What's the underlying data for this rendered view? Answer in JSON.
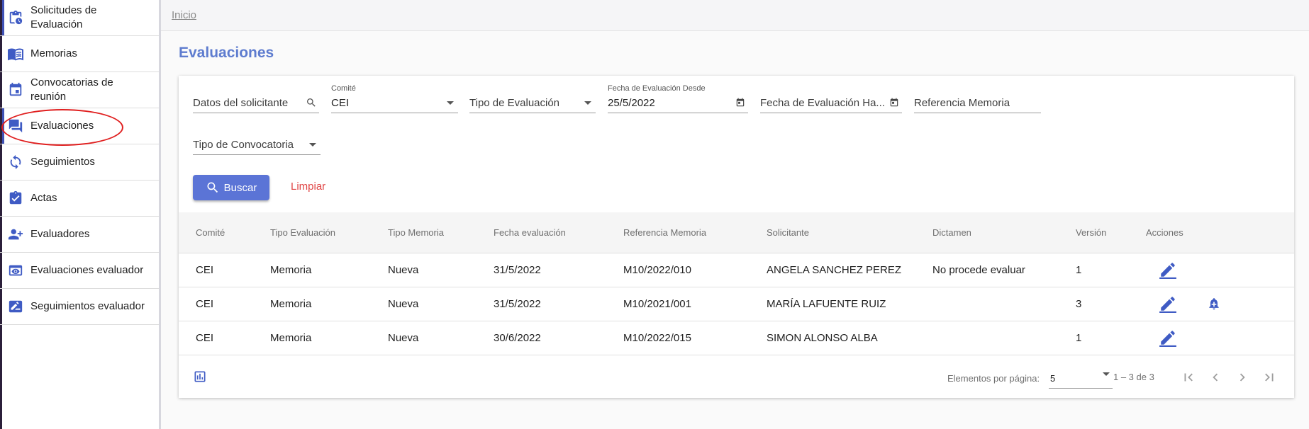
{
  "sidebar": {
    "items": [
      {
        "label_line1": "Solicitudes de",
        "label_line2": "Evaluación",
        "icon": "clipboard-clock-icon"
      },
      {
        "label": "Memorias",
        "icon": "book-icon"
      },
      {
        "label_line1": "Convocatorias de",
        "label_line2": "reunión",
        "icon": "calendar-icon"
      },
      {
        "label": "Evaluaciones",
        "icon": "chat-icon"
      },
      {
        "label": "Seguimientos",
        "icon": "sync-icon"
      },
      {
        "label": "Actas",
        "icon": "clipboard-check-icon"
      },
      {
        "label": "Evaluadores",
        "icon": "person-add-icon"
      },
      {
        "label": "Evaluaciones evaluador",
        "icon": "eye-card-icon"
      },
      {
        "label": "Seguimientos evaluador",
        "icon": "edit-card-icon"
      }
    ]
  },
  "breadcrumb": {
    "home": "Inicio"
  },
  "page": {
    "title": "Evaluaciones"
  },
  "filters": {
    "solicitante": {
      "placeholder": "Datos del solicitante"
    },
    "comite": {
      "label": "Comité",
      "value": "CEI"
    },
    "tipo_evaluacion": {
      "placeholder": "Tipo de Evaluación"
    },
    "fecha_desde": {
      "label": "Fecha de Evaluación Desde",
      "value": "25/5/2022"
    },
    "fecha_hasta": {
      "placeholder": "Fecha de Evaluación Ha..."
    },
    "referencia": {
      "placeholder": "Referencia Memoria"
    },
    "tipo_convocatoria": {
      "placeholder": "Tipo de Convocatoria"
    }
  },
  "actions": {
    "search_label": "Buscar",
    "clear_label": "Limpiar"
  },
  "table": {
    "columns": [
      "Comité",
      "Tipo Evaluación",
      "Tipo Memoria",
      "Fecha evaluación",
      "Referencia Memoria",
      "Solicitante",
      "Dictamen",
      "Versión",
      "Acciones"
    ],
    "rows": [
      {
        "comite": "CEI",
        "tipo_evaluacion": "Memoria",
        "tipo_memoria": "Nueva",
        "fecha": "31/5/2022",
        "referencia": "M10/2022/010",
        "solicitante": "ANGELA SANCHEZ PEREZ",
        "dictamen": "No procede evaluar",
        "version": "1",
        "actions": [
          "edit-icon"
        ]
      },
      {
        "comite": "CEI",
        "tipo_evaluacion": "Memoria",
        "tipo_memoria": "Nueva",
        "fecha": "31/5/2022",
        "referencia": "M10/2021/001",
        "solicitante": "MARÍA LAFUENTE RUIZ",
        "dictamen": "",
        "version": "3",
        "actions": [
          "edit-icon",
          "bell-add-icon"
        ]
      },
      {
        "comite": "CEI",
        "tipo_evaluacion": "Memoria",
        "tipo_memoria": "Nueva",
        "fecha": "30/6/2022",
        "referencia": "M10/2022/015",
        "solicitante": "SIMON ALONSO ALBA",
        "dictamen": "",
        "version": "1",
        "actions": [
          "edit-icon"
        ]
      }
    ]
  },
  "paginator": {
    "label": "Elementos por página:",
    "page_size": "5",
    "range": "1 – 3 de 3"
  },
  "colors": {
    "accent": "#5b74d6",
    "title": "#5e7ccf",
    "clear": "#e04545",
    "icon": "#3f5bc4",
    "highlight": "#e02020"
  }
}
